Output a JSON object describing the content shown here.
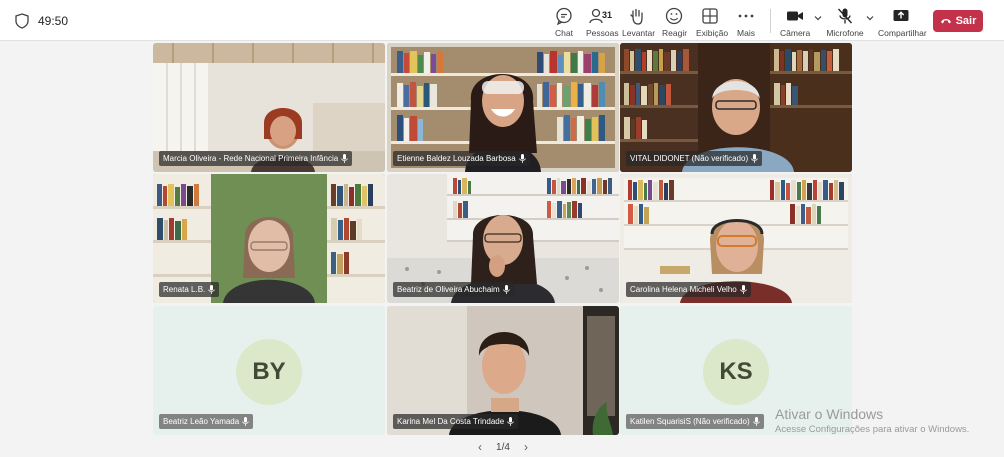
{
  "meeting": {
    "elapsed": "49:50"
  },
  "toolbar": {
    "chat": "Chat",
    "people": "Pessoas",
    "people_count": "31",
    "raise": "Levantar",
    "react": "Reagir",
    "view": "Exibição",
    "more": "Mais",
    "camera": "Câmera",
    "mic": "Microfone",
    "share": "Compartilhar",
    "leave": "Sair",
    "leave_color": "#c4314b",
    "accent_color": "#7f85f5"
  },
  "participants": [
    {
      "name": "Marcia Oliveira - Rede Nacional Primeira Infância"
    },
    {
      "name": "Etienne Baldez Louzada Barbosa"
    },
    {
      "name": "VITAL DIDONET (Não verificado)"
    },
    {
      "name": "Renata L.B."
    },
    {
      "name": "Beatriz de Oliveira Abuchaim"
    },
    {
      "name": "Carolina Helena Micheli Velho"
    },
    {
      "name": "Beatriz Leão Yamada",
      "initials": "BY"
    },
    {
      "name": "Karina Mel Da Costa Trindade"
    },
    {
      "name": "Katilen SquarisiS (Não verificado)",
      "initials": "KS"
    }
  ],
  "pager": {
    "label": "1/4"
  },
  "watermark": {
    "title": "Ativar o Windows",
    "subtitle": "Acesse Configurações para ativar o Windows."
  }
}
